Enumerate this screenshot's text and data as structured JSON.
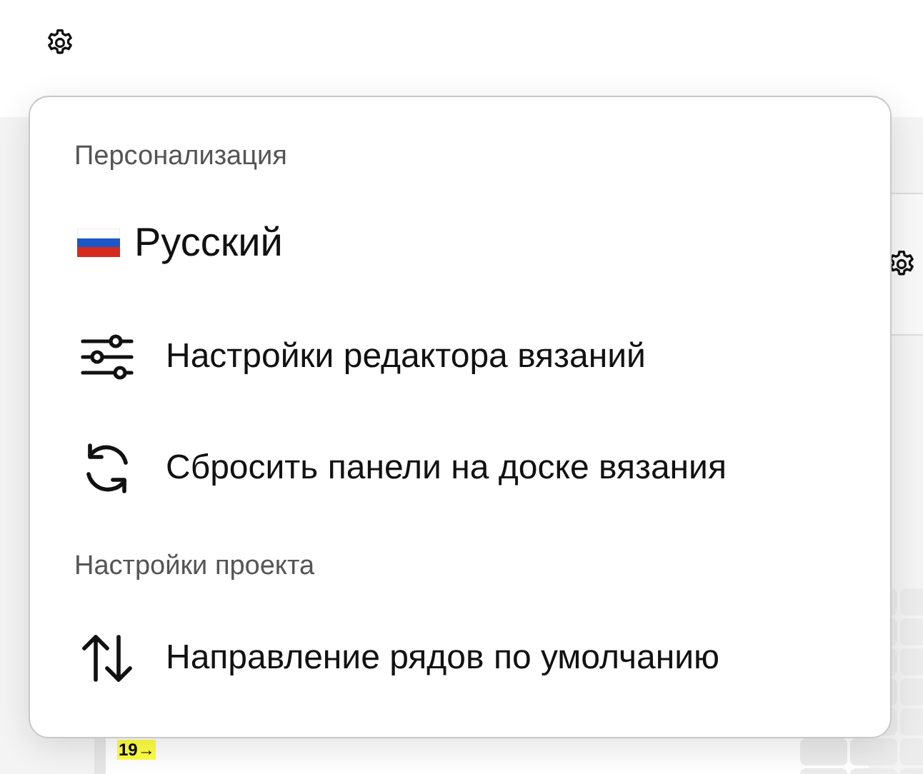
{
  "menu": {
    "sections": [
      {
        "title": "Персонализация",
        "items": [
          {
            "kind": "language",
            "label": "Русский"
          },
          {
            "kind": "sliders",
            "label": "Настройки редактора вязаний"
          },
          {
            "kind": "reset",
            "label": "Сбросить панели на доске вязания"
          }
        ]
      },
      {
        "title": "Настройки проекта",
        "items": [
          {
            "kind": "direction",
            "label": "Направление рядов по умолчанию"
          }
        ]
      }
    ]
  },
  "chart_rows": [
    {
      "label": "19→"
    }
  ]
}
